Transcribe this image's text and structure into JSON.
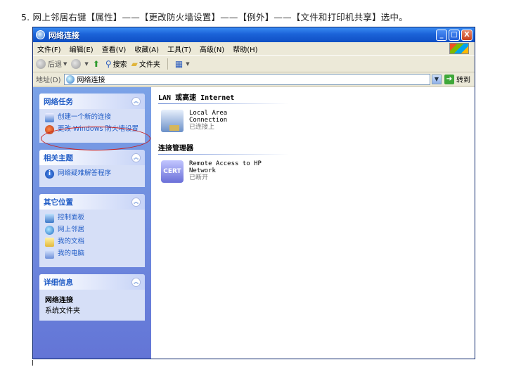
{
  "caption": "5. 网上邻居右键【属性】——【更改防火墙设置】——【例外】——【文件和打印机共享】选中。",
  "window": {
    "title": "网络连接",
    "controls": [
      "_",
      "□",
      "X"
    ]
  },
  "menubar": {
    "items": [
      "文件(F)",
      "编辑(E)",
      "查看(V)",
      "收藏(A)",
      "工具(T)",
      "高级(N)",
      "帮助(H)"
    ]
  },
  "toolbar": {
    "back": "后退",
    "search": "搜索",
    "folders": "文件夹"
  },
  "address": {
    "label": "地址(D)",
    "value": "网络连接",
    "go": "转到"
  },
  "sidebar": {
    "network_tasks": {
      "header": "网络任务",
      "items": [
        "创建一个新的连接",
        "更改 Windows 防火墙设置"
      ]
    },
    "related": {
      "header": "相关主题",
      "items": [
        "网络疑难解答程序"
      ]
    },
    "other_places": {
      "header": "其它位置",
      "items": [
        "控制面板",
        "网上邻居",
        "我的文档",
        "我的电脑"
      ]
    },
    "details": {
      "header": "详细信息",
      "title": "网络连接",
      "subtitle": "系统文件夹"
    }
  },
  "content": {
    "lan_group": "LAN 或高速 Internet",
    "lan_connection": {
      "line1": "Local Area",
      "line2": "Connection",
      "status": "已连接上"
    },
    "manager_group": "连接管理器",
    "remote": {
      "line1": "Remote Access to HP",
      "line2": "Network",
      "status": "已断开",
      "icon_text": "CERT"
    }
  },
  "colors": {
    "titlebar": "#1b63d8",
    "sidebar": "#6f8ed6",
    "link": "#215dc6",
    "annotation": "#c82020"
  }
}
